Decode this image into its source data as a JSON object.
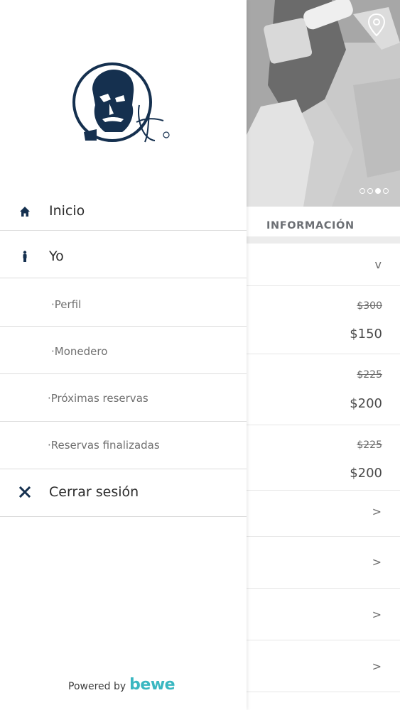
{
  "hero": {
    "slides": [
      false,
      false,
      true,
      false
    ]
  },
  "info_tab": {
    "label": "INFORMACIÓN"
  },
  "service_rows": [
    {
      "chevron": "v"
    },
    {
      "old_price": "$300",
      "new_price": "$150"
    },
    {
      "old_price": "$225",
      "new_price": "$200"
    },
    {
      "old_price": "$225",
      "new_price": "$200"
    },
    {
      "chevron": ">"
    },
    {
      "chevron": ">"
    },
    {
      "chevron": ">"
    },
    {
      "chevron": ">"
    }
  ],
  "menu": {
    "home": {
      "label": "Inicio",
      "icon": "home-icon"
    },
    "me": {
      "label": "Yo",
      "icon": "person-icon"
    },
    "profile": {
      "label": "·Perfil"
    },
    "wallet": {
      "label": "·Monedero"
    },
    "upcoming": {
      "label": "·Próximas reservas"
    },
    "finished": {
      "label": "·Reservas finalizadas"
    },
    "logout": {
      "label": "Cerrar sesión",
      "icon": "close-icon"
    }
  },
  "footer": {
    "powered_text": "Powered by",
    "brand": "bewe"
  },
  "colors": {
    "navy": "#15304f",
    "accent": "#3ab7c1"
  }
}
